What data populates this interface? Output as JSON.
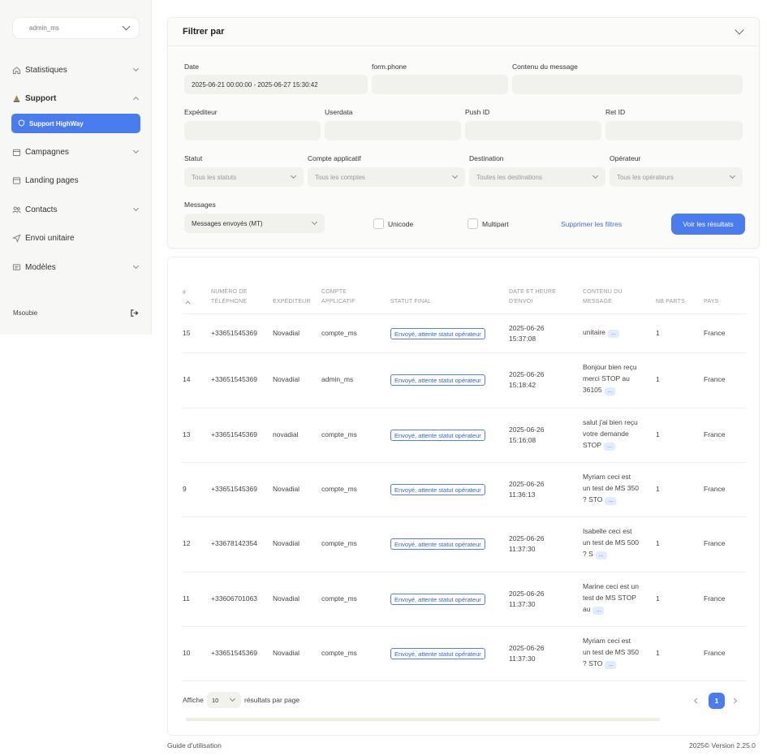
{
  "sidebar": {
    "account": "admin_ms",
    "items": [
      {
        "label": "Statistiques"
      },
      {
        "label": "Support"
      },
      {
        "label": "Campagnes"
      },
      {
        "label": "Landing pages"
      },
      {
        "label": "Contacts"
      },
      {
        "label": "Envoi unitaire"
      },
      {
        "label": "Modèles"
      }
    ],
    "sub_item": "Support HighWay",
    "user": "Msoubie"
  },
  "filter": {
    "title": "Filtrer par",
    "date_label": "Date",
    "date_value": "2025-06-21 00:00:00 - 2025-06-27 15:30:42",
    "phone_label": "form.phone",
    "message_label": "Contenu du message",
    "sender_label": "Expéditeur",
    "userdata_label": "Userdata",
    "pushid_label": "Push ID",
    "retid_label": "Ret ID",
    "status_label": "Statut",
    "status_placeholder": "Tous les statuts",
    "account_label": "Compte applicatif",
    "account_placeholder": "Tous les comptes",
    "destination_label": "Destination",
    "destination_placeholder": "Toutes les destinations",
    "operator_label": "Opérateur",
    "operator_placeholder": "Tous les opérateurs",
    "messages_label": "Messages",
    "messages_value": "Messages envoyés (MT)",
    "unicode_label": "Unicode",
    "multipart_label": "Multipart",
    "clear_label": "Supprimer les filtres",
    "submit_label": "Voir les résultats"
  },
  "table": {
    "headers": {
      "num": "#",
      "phone1": "NUMÉRO DE",
      "phone2": "TÉLÉPHONE",
      "sender": "EXPÉDITEUR",
      "account1": "COMPTE",
      "account2": "APPLICATIF",
      "status": "STATUT FINAL",
      "date1": "DATE ET HEURE",
      "date2": "D'ENVOI",
      "content1": "CONTENU DU",
      "content2": "MESSAGE",
      "parts": "NB PARTS",
      "country": "PAYS"
    },
    "sort_icon": "sort-ascending-icon",
    "rows": [
      {
        "id": "15",
        "phone": "+33651545369",
        "sender": "Novadial",
        "account": "compte_ms",
        "status": "Envoyé, attente statut opérateur",
        "date": "2025-06-26",
        "time": "15:37:08",
        "content": [
          "unitaire"
        ],
        "parts": "1",
        "country": "France"
      },
      {
        "id": "14",
        "phone": "+33651545369",
        "sender": "Novadial",
        "account": "admin_ms",
        "status": "Envoyé, attente statut opérateur",
        "date": "2025-06-26",
        "time": "15:18:42",
        "content": [
          "Bonjour bien reçu",
          "merci STOP au",
          "36105"
        ],
        "parts": "1",
        "country": "France"
      },
      {
        "id": "13",
        "phone": "+33651545369",
        "sender": "novadial",
        "account": "compte_ms",
        "status": "Envoyé, attente statut opérateur",
        "date": "2025-06-26",
        "time": "15:16:08",
        "content": [
          "salut j'ai bien reçu",
          "votre demande",
          "STOP"
        ],
        "parts": "1",
        "country": "France"
      },
      {
        "id": "9",
        "phone": "+33651545369",
        "sender": "Novadial",
        "account": "compte_ms",
        "status": "Envoyé, attente statut opérateur",
        "date": "2025-06-26",
        "time": "11:36:13",
        "content": [
          "Myriam ceci est",
          "un test de MS 350",
          "? STO"
        ],
        "parts": "1",
        "country": "France"
      },
      {
        "id": "12",
        "phone": "+33678142354",
        "sender": "Novadial",
        "account": "compte_ms",
        "status": "Envoyé, attente statut opérateur",
        "date": "2025-06-26",
        "time": "11:37:30",
        "content": [
          "Isabelle ceci est",
          "un test de MS 500",
          "? S"
        ],
        "parts": "1",
        "country": "France"
      },
      {
        "id": "11",
        "phone": "+33606701063",
        "sender": "Novadial",
        "account": "compte_ms",
        "status": "Envoyé, attente statut opérateur",
        "date": "2025-06-26",
        "time": "11:37:30",
        "content": [
          "Marine ceci est un",
          "test de MS STOP",
          "au"
        ],
        "parts": "1",
        "country": "France"
      },
      {
        "id": "10",
        "phone": "+33651545369",
        "sender": "Novadial",
        "account": "compte_ms",
        "status": "Envoyé, attente statut opérateur",
        "date": "2025-06-26",
        "time": "11:37:30",
        "content": [
          "Myriam ceci est",
          "un test de MS 350",
          "? STO"
        ],
        "parts": "1",
        "country": "France"
      }
    ],
    "more_label": "..."
  },
  "pagination": {
    "show_label": "Affiche",
    "per_page": "10",
    "per_page_suffix": "résultats par page",
    "current_page": "1",
    "prev_icon": "chevron-left-icon",
    "next_icon": "chevron-right-icon"
  },
  "footer": {
    "guide": "Guide d'utilisation",
    "version": "2025©  Version 2.25.0"
  },
  "colors": {
    "accent": "#4a7cf0",
    "sidebar_bg": "#f7f7f5",
    "badge_border": "#5a7fe0"
  }
}
